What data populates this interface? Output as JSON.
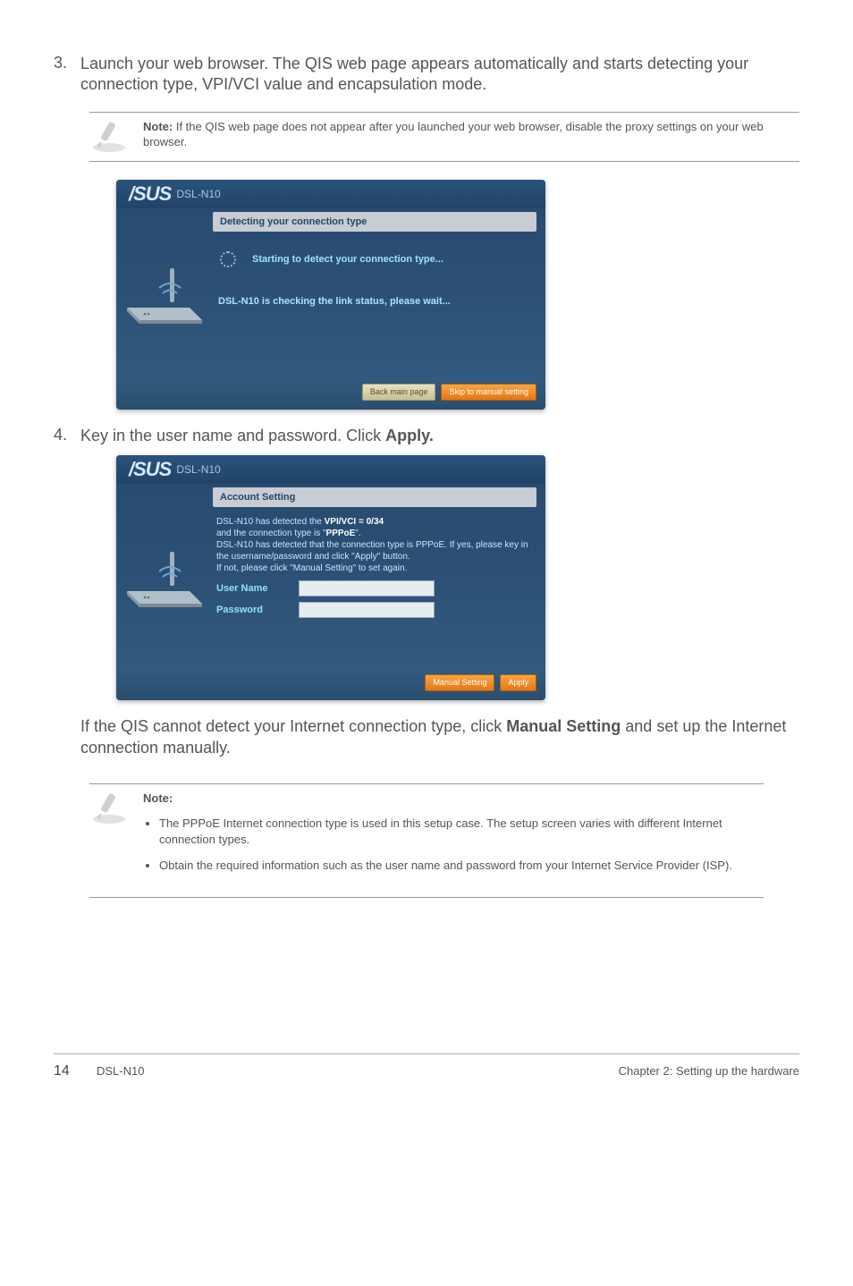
{
  "step3": {
    "num": "3.",
    "text": "Launch your web browser. The QIS web page appears automatically and starts detecting your connection type, VPI/VCI value and encapsulation mode."
  },
  "note1": {
    "label": "Note:",
    "text": " If the QIS web page does not appear after you launched your web browser, disable the proxy settings on your web browser."
  },
  "panel1": {
    "model": "DSL-N10",
    "title": "Detecting your connection type",
    "spin_text": "Starting to detect your connection type...",
    "status": "DSL-N10 is checking the link status, please wait...",
    "btn_back": "Back main page",
    "btn_skip": "Skip to manual setting"
  },
  "step4": {
    "num": "4.",
    "text_pre": "Key in the user name and password. Click ",
    "text_bold": "Apply."
  },
  "panel2": {
    "model": "DSL-N10",
    "title": "Account Setting",
    "info_l1a": "DSL-N10 has detected the ",
    "info_l1b": "VPI/VCI = 0/34",
    "info_l2a": "and the connection type is \"",
    "info_l2b": "PPPoE",
    "info_l2c": "\".",
    "info_l3": "DSL-N10 has detected that the connection type is PPPoE. If yes, please key in the username/password and click \"Apply\" button.",
    "info_l4": "If not, please click \"Manual Setting\" to set again.",
    "user_label": "User Name",
    "pass_label": "Password",
    "btn_manual": "Manual Setting",
    "btn_apply": "Apply"
  },
  "after_panel": {
    "text_pre": "If the QIS cannot detect your Internet connection type, click ",
    "text_bold": "Manual Setting",
    "text_post": " and set up the Internet connection manually."
  },
  "note2": {
    "label": "Note:",
    "b1": "The PPPoE Internet connection type is used in this setup case. The setup screen varies with different Internet connection types.",
    "b2": "Obtain the required information such as the user name and password from your Internet Service Provider (ISP)."
  },
  "footer": {
    "page": "14",
    "model": "DSL-N10",
    "chapter": "Chapter 2: Setting up the hardware"
  }
}
